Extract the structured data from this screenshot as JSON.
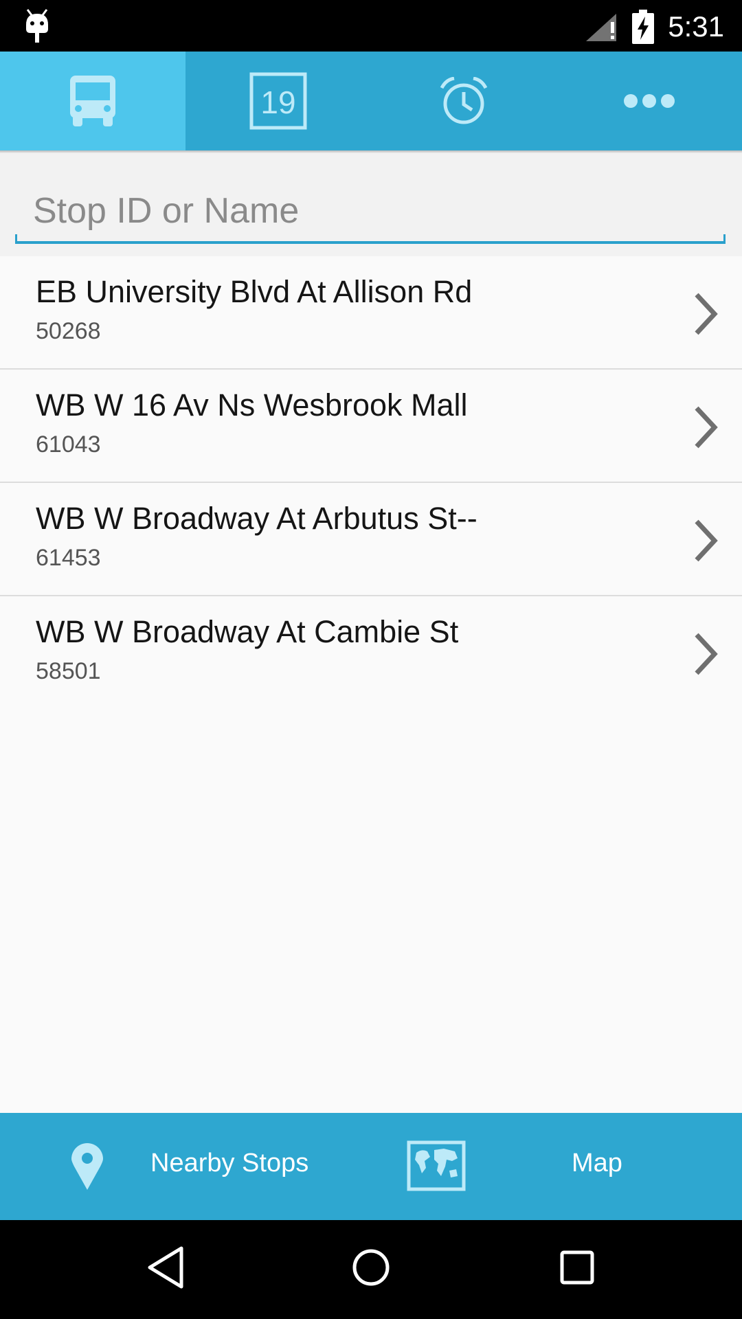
{
  "status_bar": {
    "time": "5:31",
    "icons": [
      "android-debug-icon",
      "signal-icon",
      "battery-charging-icon"
    ]
  },
  "tabs": [
    {
      "name": "bus",
      "icon": "bus-icon",
      "active": true
    },
    {
      "name": "calendar",
      "icon": "calendar-icon",
      "calendar_day": "19",
      "active": false
    },
    {
      "name": "alarm",
      "icon": "alarm-clock-icon",
      "active": false
    },
    {
      "name": "more",
      "icon": "more-icon",
      "active": false
    }
  ],
  "search": {
    "placeholder": "Stop ID or Name",
    "value": ""
  },
  "stops": [
    {
      "name": "EB University Blvd At Allison Rd",
      "id": "50268"
    },
    {
      "name": "WB W 16 Av Ns Wesbrook Mall",
      "id": "61043"
    },
    {
      "name": "WB W Broadway At Arbutus St--",
      "id": "61453"
    },
    {
      "name": "WB W Broadway At Cambie St",
      "id": "58501"
    }
  ],
  "bottom_bar": {
    "nearby_label": "Nearby Stops",
    "map_label": "Map"
  },
  "colors": {
    "primary": "#2ea7d0",
    "primary_active": "#4ec6ec",
    "icon_light": "#bdeaf8"
  }
}
